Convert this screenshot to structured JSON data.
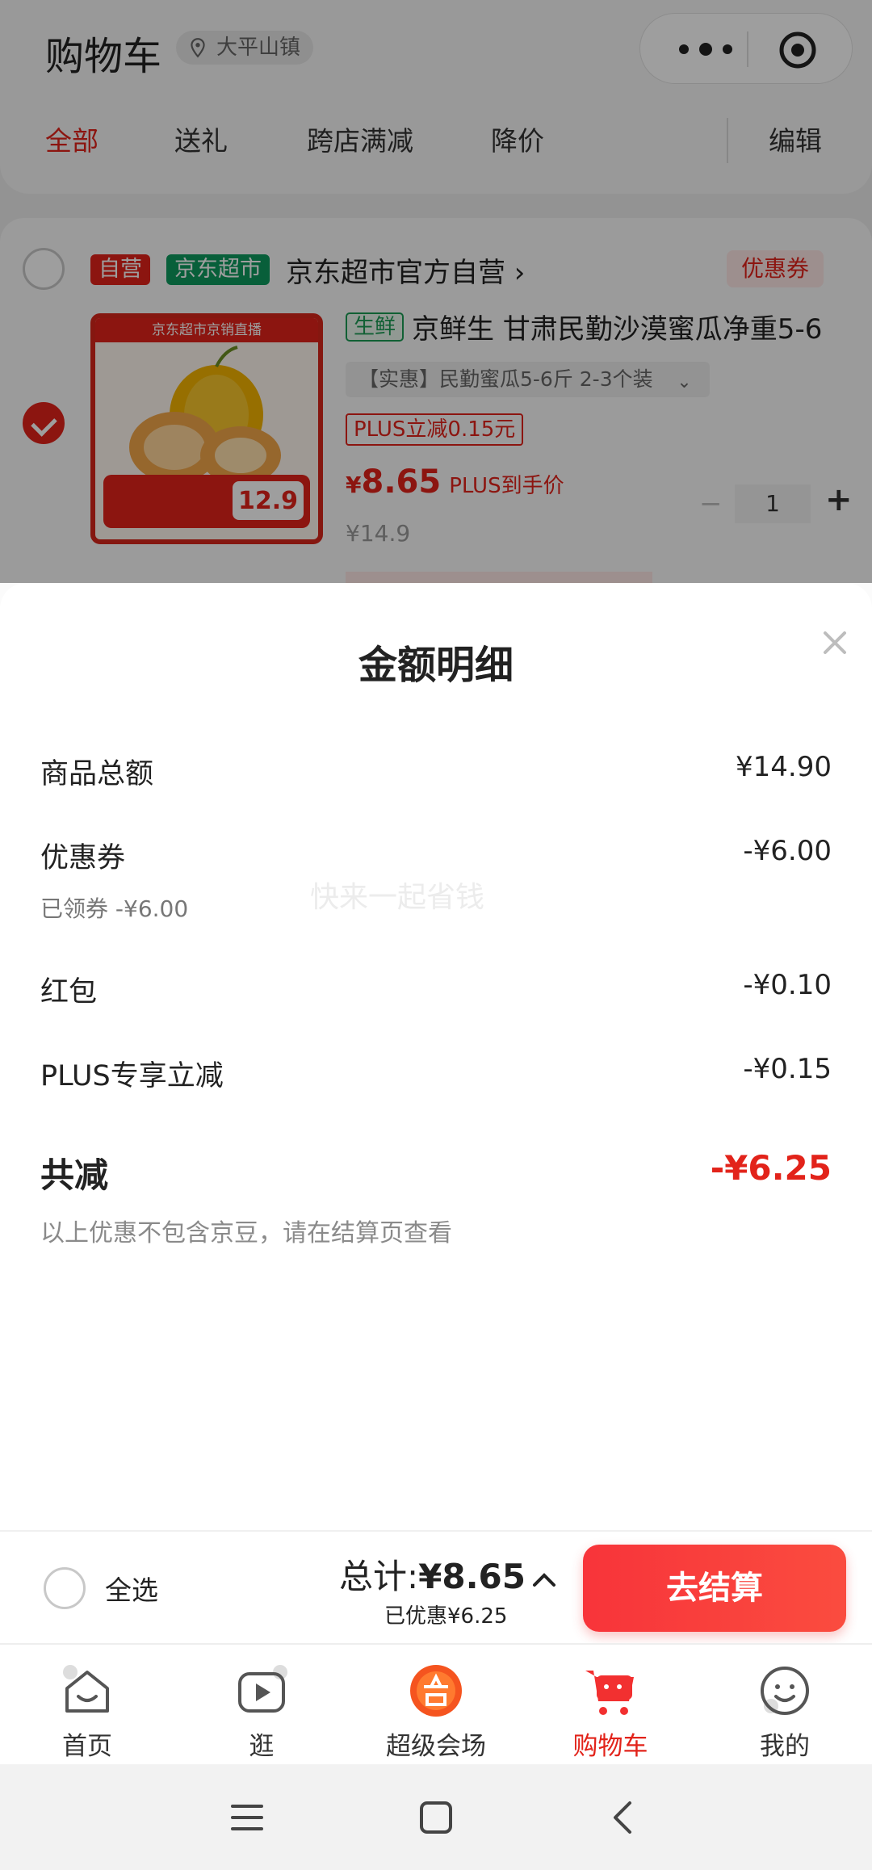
{
  "header": {
    "title": "购物车",
    "location": "大平山镇",
    "tabs": [
      "全部",
      "送礼",
      "跨店满减",
      "降价"
    ],
    "edit": "编辑"
  },
  "shop": {
    "tag_self": "自营",
    "tag_supermarket": "京东超市",
    "name": "京东超市官方自营 ›",
    "coupon": "优惠券"
  },
  "product": {
    "fresh_tag": "生鲜",
    "name": "京鲜生 甘肃民勤沙漠蜜瓜净重5-6",
    "spec": "【实惠】民勤蜜瓜5-6斤 2-3个装",
    "plus_discount": "PLUS立减0.15元",
    "price_symbol": "¥",
    "price": "8.65",
    "plus_label": "PLUS到手价",
    "original_price": "¥14.9",
    "quantity": "1",
    "image_banner": "京东超市京销直播",
    "image_price": "12.9"
  },
  "sheet": {
    "title": "金额明细",
    "watermark": "快来一起省钱",
    "rows": [
      {
        "label": "商品总额",
        "value": "¥14.90"
      },
      {
        "label": "优惠券",
        "value": "-¥6.00",
        "sub": "已领券 -¥6.00"
      },
      {
        "label": "红包",
        "value": "-¥0.10"
      },
      {
        "label": "PLUS专享立减",
        "value": "-¥0.15"
      }
    ],
    "total_label": "共减",
    "total_value": "-¥6.25",
    "note": "以上优惠不包含京豆，请在结算页查看"
  },
  "checkout": {
    "select_all": "全选",
    "total_prefix": "总计:",
    "total_amount": "¥8.65",
    "saved": "已优惠¥6.25",
    "button": "去结算"
  },
  "tabbar": [
    {
      "label": "首页",
      "icon": "home-icon"
    },
    {
      "label": "逛",
      "icon": "video-icon"
    },
    {
      "label": "超级会场",
      "icon": "super-venue-icon"
    },
    {
      "label": "购物车",
      "icon": "cart-icon",
      "active": true
    },
    {
      "label": "我的",
      "icon": "profile-icon"
    }
  ],
  "colors": {
    "accent": "#e2231a",
    "green": "#0e9a5e",
    "checkout_button": "#f8343a"
  }
}
